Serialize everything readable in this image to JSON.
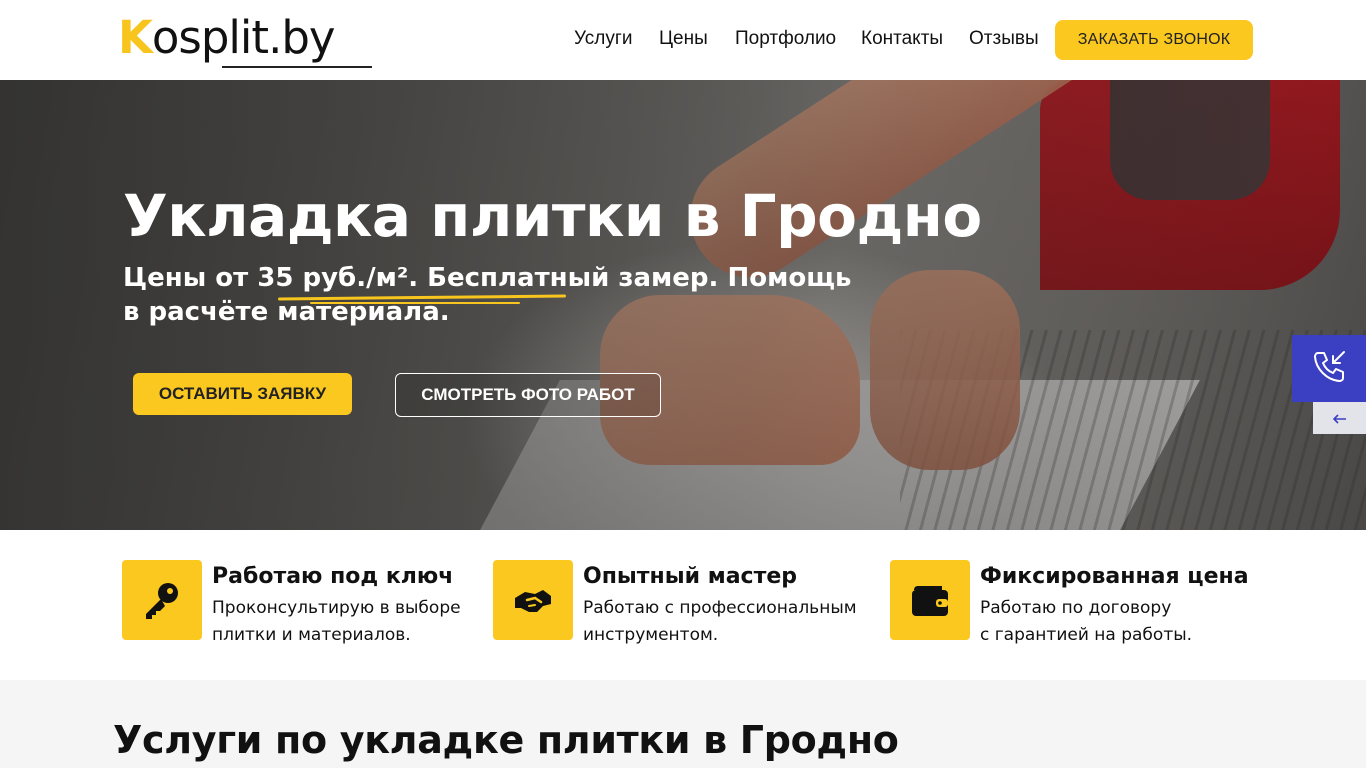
{
  "header": {
    "logo_text_k": "K",
    "logo_text_rest": "osplit.by",
    "nav": [
      "Услуги",
      "Цены",
      "Портфолио",
      "Контакты",
      "Отзывы"
    ],
    "cta_label": "ЗАКАЗАТЬ ЗВОНОК"
  },
  "hero": {
    "title": "Укладка плитки в Гродно",
    "subtitle_part1": "Цены от 35 руб./м². ",
    "subtitle_highlight": "Бесплатный замер.",
    "subtitle_part2": " Помощь в расчёте материала.",
    "primary_button": "ОСТАВИТЬ ЗАЯВКУ",
    "secondary_button": "СМОТРЕТЬ ФОТО РАБОТ"
  },
  "features": [
    {
      "icon": "key-icon",
      "title": "Работаю под ключ",
      "line1": "Проконсультирую в выборе",
      "line2": "плитки и материалов."
    },
    {
      "icon": "handshake-icon",
      "title": "Опытный мастер",
      "line1": "Работаю с профессиональным",
      "line2": "инструментом."
    },
    {
      "icon": "wallet-icon",
      "title": "Фиксированная цена",
      "line1": "Работаю по договору",
      "line2": "с гарантией на работы."
    }
  ],
  "widget": {
    "icon": "phone-incoming-icon",
    "tab_icon": "arrow-left-icon"
  },
  "services": {
    "title": "Услуги по укладке плитки в Гродно"
  },
  "colors": {
    "accent": "#fbc820",
    "widget": "#3b3fc2",
    "text": "#111111"
  }
}
